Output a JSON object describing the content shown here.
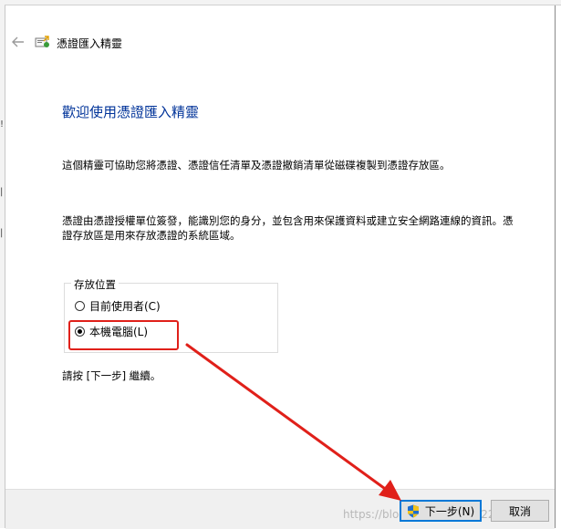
{
  "wizard": {
    "title": "憑證匯入精靈",
    "heading": "歡迎使用憑證匯入精靈",
    "para1": "這個精靈可協助您將憑證、憑證信任清單及憑證撤銷清單從磁碟複製到憑證存放區。",
    "para2": "憑證由憑證授權單位簽發，能識別您的身分，並包含用來保護資料或建立安全網路連線的資訊。憑證存放區是用來存放憑證的系統區域。",
    "group_label": "存放位置",
    "options": [
      {
        "label": "目前使用者(C)",
        "selected": false
      },
      {
        "label": "本機電腦(L)",
        "selected": true
      }
    ],
    "instruction": "請按 [下一步] 繼續。"
  },
  "buttons": {
    "next": "下一步(N)",
    "cancel": "取消"
  },
  "watermark": "https://blog.csdn.net/u012264...47",
  "annotation": {
    "color": "#e0201a"
  },
  "icons": [
    "back-arrow-icon",
    "certificate-wizard-icon",
    "uac-shield-icon"
  ]
}
